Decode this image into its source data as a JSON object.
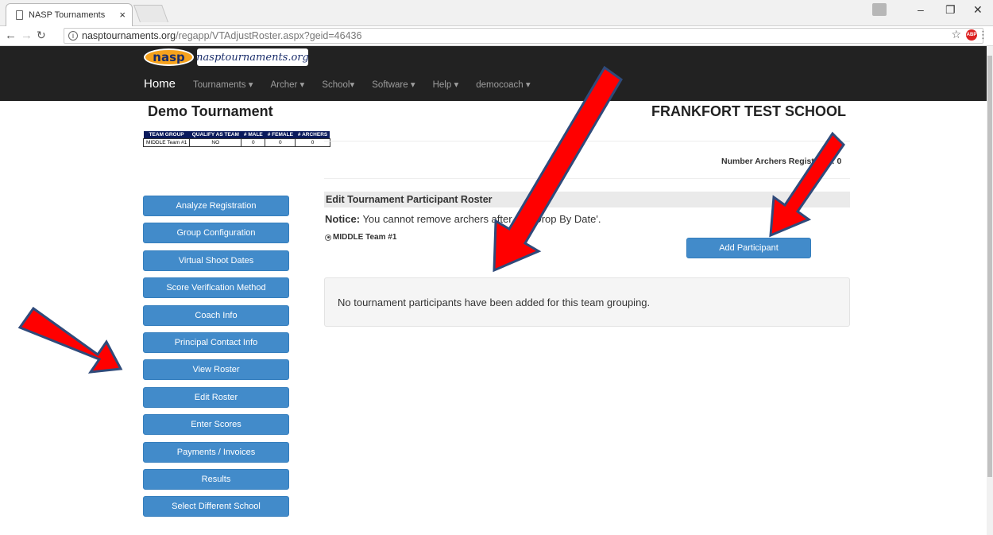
{
  "browser": {
    "tab_title": "NASP Tournaments",
    "tab_close": "×",
    "url_host": "nasptournaments.org",
    "url_path": "/regapp/VTAdjustRoster.aspx?geid=46436",
    "info_glyph": "i",
    "abp_label": "ABP"
  },
  "site": {
    "logo_text": "nasp",
    "logo_domain": "nasptournaments.org",
    "nav": {
      "home": "Home",
      "tournaments": "Tournaments ▾",
      "archer": "Archer ▾",
      "school": "School▾",
      "software": "Software ▾",
      "help": "Help ▾",
      "user": "democoach ▾"
    }
  },
  "header": {
    "tournament": "Demo Tournament",
    "school": "FRANKFORT TEST SCHOOL",
    "number_archers": "Number Archers Registered: 0"
  },
  "summary_table": {
    "headers": [
      "TEAM GROUP",
      "QUALIFY AS TEAM",
      "# MALE",
      "# FEMALE",
      "# ARCHERS"
    ],
    "rows": [
      [
        "MIDDLE Team #1",
        "NO",
        "0",
        "0",
        "0"
      ]
    ]
  },
  "sidebar": {
    "items": [
      "Analyze Registration",
      "Group Configuration",
      "Virtual Shoot Dates",
      "Score Verification Method",
      "Coach Info",
      "Principal Contact Info",
      "View Roster",
      "Edit Roster",
      "Enter Scores",
      "Payments / Invoices",
      "Results",
      "Select Different School"
    ]
  },
  "main": {
    "panel_title": "Edit Tournament Participant Roster",
    "notice_label": "Notice:",
    "notice_text": " You cannot remove archers after the 'Drop By Date'.",
    "team_option": "MIDDLE Team #1",
    "add_button": "Add Participant",
    "empty_message": "No tournament participants have been added for this team grouping."
  },
  "colors": {
    "primary_button": "#428bca",
    "navbar": "#222222",
    "arrow": "#ff0000",
    "arrow_outline": "#2f4a7a"
  }
}
